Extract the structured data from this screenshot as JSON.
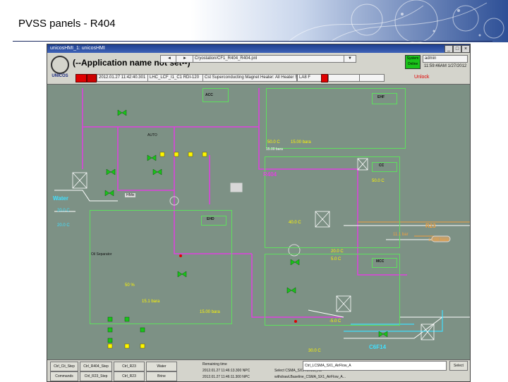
{
  "slide": {
    "title": "PVSS panels - R404"
  },
  "window": {
    "title": "unicosHMI_1: unicosHMI"
  },
  "header": {
    "app_name": "(--Application name not set--)",
    "panel_path": "Cryostation/CF1_R404_R404.pnl",
    "user": "admin",
    "time": "11:59:46AM 1/27/2012",
    "system_label": "System Online",
    "event_time": "2012.01.27 11:42:40.301",
    "event_device": "LHC_LCF_I1_C1 RDI-120",
    "event_text": "Cst Superconducting Magnet Heater: All Heater Status",
    "event_right": "LA8 F",
    "unlock": "Unlock"
  },
  "synoptic": {
    "labels": {
      "r404": "R404",
      "water": "Water",
      "r23": "R23",
      "c6f14": "C6F14",
      "acc": "ACC",
      "ehf": "EHF",
      "cc": "CC",
      "ehd": "EHD",
      "mcc": "MCC",
      "mix": "MIX",
      "auto": "AUTO",
      "hmix": "HMix",
      "oil": "Oil Separator"
    },
    "values": {
      "v1": "50.0 C",
      "v2": "15.00 bara",
      "v3": "50.0 C",
      "v4": "15.00 bara",
      "v5": "40.0 C",
      "v6": "20.0 C",
      "v7": "20.0 C",
      "v8": "15.00 bara",
      "v9": "11.1 bar",
      "v10": "20.0 C",
      "v11": "5.0 C",
      "v12": "50 %",
      "v13": "15.1 bara",
      "v14": "15.00 bara",
      "v15": "-5.0 C",
      "v16": "30.0 C"
    }
  },
  "footer": {
    "buttons": [
      "Ctrl_Cit_Step",
      "Ctrl_R404_Step",
      "Ctrl_R23",
      "Water",
      "Commands",
      "Ctrl_R23_Step",
      "Ctrl_R23",
      "Brine"
    ],
    "remaining_time": "Remaining time",
    "line1": "2012.01.27 11:46:13.300 NPC",
    "line2": "2012.01.27 11:46:11.300 NPC",
    "line1_device": "Select CSMA_SX1 Airflow_A5",
    "line2_device": "withdrawLBaseline_CSMA_SX1_AirFlow_A...",
    "device_sel": "Ctrl_LCSMA_SX1_AirFlow_A",
    "select": "Select"
  }
}
